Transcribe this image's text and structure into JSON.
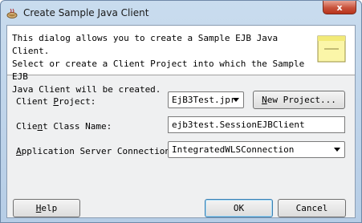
{
  "window": {
    "title": "Create Sample Java Client",
    "close_label": "x"
  },
  "intro": {
    "text": "This dialog allows you to create a Sample EJB Java Client.\nSelect or create a Client Project into which the Sample EJB\nJava Client will be created."
  },
  "form": {
    "client_project": {
      "label_pre": "Client ",
      "label_ul": "P",
      "label_post": "roject:",
      "value": "EjB3Test.jpr",
      "new_button_pre": "",
      "new_button_ul": "N",
      "new_button_post": "ew Project..."
    },
    "client_class_name": {
      "label_pre": "Clie",
      "label_ul": "n",
      "label_post": "t Class Name:",
      "value": "ejb3test.SessionEJBClient"
    },
    "app_server_connection": {
      "label_pre": "",
      "label_ul": "A",
      "label_post": "pplication Server Connection:",
      "value": "IntegratedWLSConnection"
    }
  },
  "buttons": {
    "help_pre": "",
    "help_ul": "H",
    "help_post": "elp",
    "ok": "OK",
    "cancel": "Cancel"
  }
}
